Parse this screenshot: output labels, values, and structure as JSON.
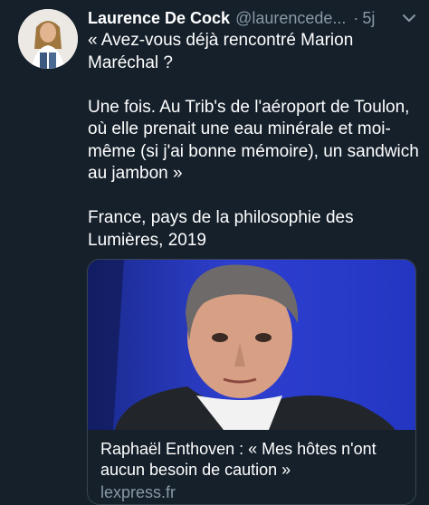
{
  "tweet": {
    "author_name": "Laurence De Cock",
    "handle": "@laurencede...",
    "separator": "·",
    "time": "5j",
    "paragraphs": [
      "« Avez-vous déjà rencontré Marion Maréchal ?",
      "Une fois. Au Trib's de l'aéroport de Toulon, où elle prenait une eau minérale et moi-même (si j'ai bonne mémoire), un sandwich au jambon »",
      "France, pays de la philosophie des Lumières, 2019"
    ]
  },
  "card": {
    "title": "Raphaël Enthoven : « Mes hôtes n'ont aucun besoin de caution »",
    "domain": "lexpress.fr"
  },
  "colors": {
    "background": "#15202b",
    "secondary_text": "#8899a6",
    "card_border": "#38444d"
  },
  "icons": {
    "more": "chevron-down-icon"
  }
}
